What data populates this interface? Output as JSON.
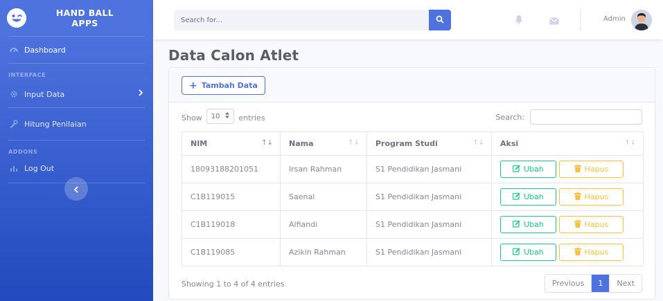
{
  "brand": {
    "line1": "HAND BALL",
    "line2": "APPS",
    "logo_icon": "laugh-wink-icon"
  },
  "sidebar": {
    "dashboard": {
      "label": "Dashboard",
      "icon": "tachometer-icon"
    },
    "heading_interface": "INTERFACE",
    "input_data": {
      "label": "Input Data",
      "icon": "cog-icon"
    },
    "hitung": {
      "label": "Hitung Penilaian",
      "icon": "wrench-icon"
    },
    "heading_addons": "ADDONS",
    "logout": {
      "label": "Log Out",
      "icon": "chart-icon"
    }
  },
  "topbar": {
    "search_placeholder": "Search for...",
    "username": "Admin"
  },
  "page": {
    "title": "Data Calon Atlet"
  },
  "toolbar": {
    "add_label": "Tambah Data"
  },
  "datatable": {
    "show_label": "Show",
    "entries_value": "10",
    "entries_label": "entries",
    "search_label": "Search:",
    "columns": [
      "NIM",
      "Nama",
      "Program Studi",
      "Aksi"
    ],
    "rows": [
      {
        "nim": "18093188201051",
        "nama": "Irsan Rahman",
        "prodi": "S1 Pendidikan Jasmani"
      },
      {
        "nim": "C1B119015",
        "nama": "Saenal",
        "prodi": "S1 Pendidikan Jasmani"
      },
      {
        "nim": "C1B119018",
        "nama": "Alfiandi",
        "prodi": "S1 Pendidikan Jasmani"
      },
      {
        "nim": "C1B119085",
        "nama": "Azikin Rahman",
        "prodi": "S1 Pendidikan Jasmani"
      }
    ],
    "edit_label": "Ubah",
    "delete_label": "Hapus",
    "info": "Showing 1 to 4 of 4 entries",
    "pager": {
      "previous": "Previous",
      "current": "1",
      "next": "Next"
    }
  },
  "colors": {
    "primary": "#4e73df",
    "success": "#1cc88a",
    "warning": "#f6c23e"
  }
}
